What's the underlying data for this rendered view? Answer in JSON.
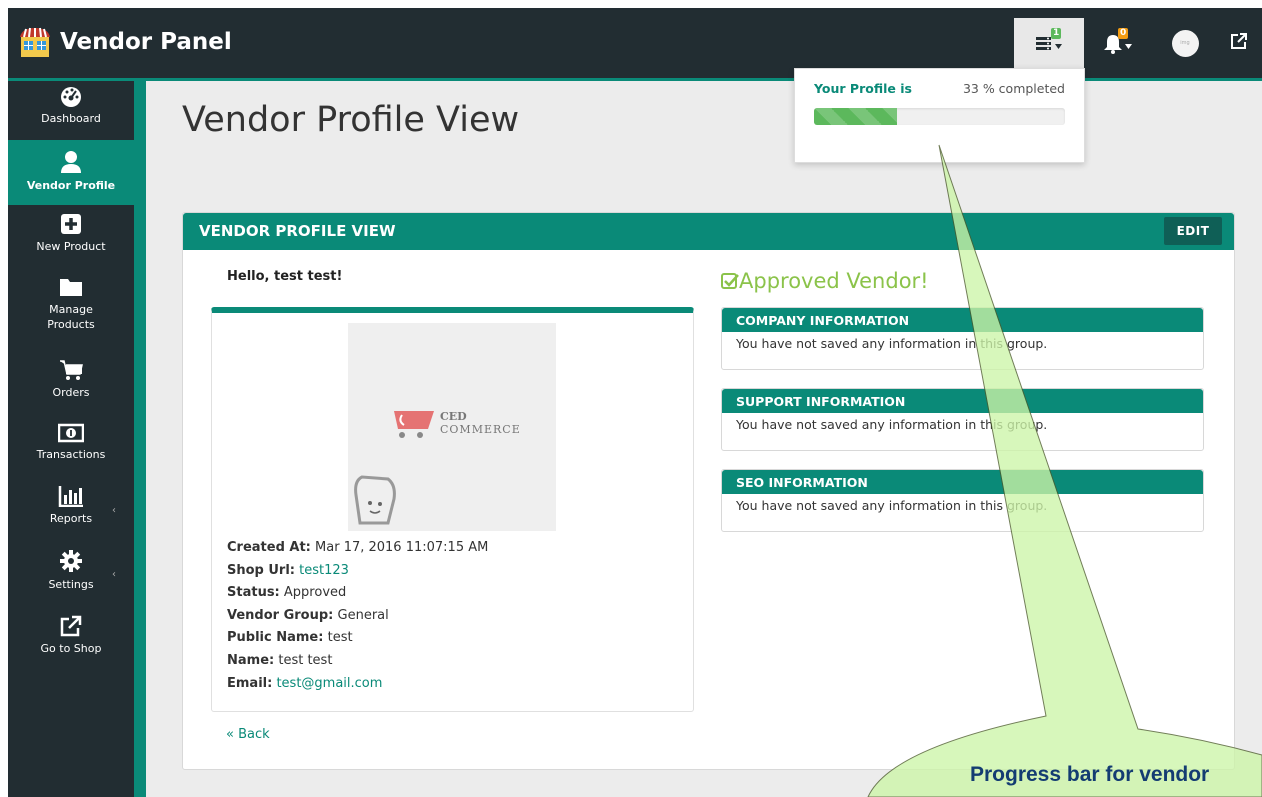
{
  "app": {
    "title": "Vendor Panel",
    "accent_color": "#0a8a78",
    "dark_color": "#222d32"
  },
  "topbar": {
    "progress_icon": "progress-server-icon",
    "progress_badge": "1",
    "notifications_badge": "0",
    "avatar_text": "img",
    "external_icon": "external-link-icon"
  },
  "profile_progress": {
    "label": "Your Profile is",
    "percent_text": "33 % completed",
    "percent": 33
  },
  "sidebar": {
    "items": [
      {
        "label": "Dashboard",
        "icon": "dashboard-icon",
        "active": false
      },
      {
        "label": "Vendor Profile",
        "icon": "user-icon",
        "active": true
      },
      {
        "label": "New Product",
        "icon": "plus-square-icon",
        "active": false
      },
      {
        "label": "Manage Products",
        "icon": "folder-icon",
        "active": false
      },
      {
        "label": "Orders",
        "icon": "cart-icon",
        "active": false
      },
      {
        "label": "Transactions",
        "icon": "money-icon",
        "active": false
      },
      {
        "label": "Reports",
        "icon": "bar-chart-icon",
        "active": false,
        "caret": "‹"
      },
      {
        "label": "Settings",
        "icon": "gear-icon",
        "active": false,
        "caret": "‹"
      },
      {
        "label": "Go to Shop",
        "icon": "external-link-icon",
        "active": false
      }
    ]
  },
  "page": {
    "title": "Vendor Profile View"
  },
  "profile_box": {
    "title": "VENDOR PROFILE VIEW",
    "edit_label": "EDIT",
    "greeting": "Hello, test test!",
    "image_brand_top": "CED",
    "image_brand_bottom": "COMMERCE",
    "details": {
      "created_at_label": "Created At:",
      "created_at": "Mar 17, 2016 11:07:15 AM",
      "shop_url_label": "Shop Url:",
      "shop_url": "test123",
      "status_label": "Status:",
      "status": "Approved",
      "vendor_group_label": "Vendor Group:",
      "vendor_group": "General",
      "public_name_label": "Public Name:",
      "public_name": "test",
      "name_label": "Name:",
      "name": "test test",
      "email_label": "Email:",
      "email": "test@gmail.com"
    },
    "back_label": "« Back",
    "approved_text": "Approved Vendor!",
    "approved_color": "#8bc34a",
    "sections": [
      {
        "title": "COMPANY INFORMATION",
        "body": "You have not saved any information in this group."
      },
      {
        "title": "SUPPORT INFORMATION",
        "body": "You have not saved any information in this group."
      },
      {
        "title": "SEO INFORMATION",
        "body": "You have not saved any information in this group."
      }
    ]
  },
  "callout": {
    "text": "Progress bar for vendor",
    "fill_color": "#cdf5a8"
  }
}
